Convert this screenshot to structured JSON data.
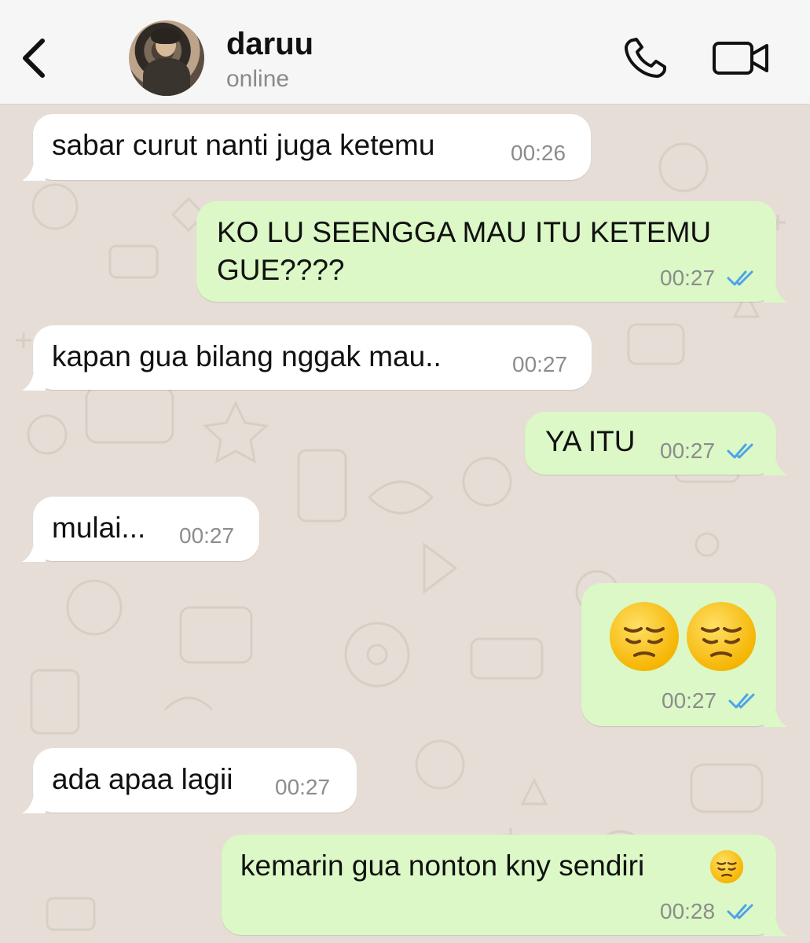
{
  "contact": {
    "name": "daruu",
    "status": "online"
  },
  "colors": {
    "incoming_bubble": "#ffffff",
    "outgoing_bubble": "#dbf8c6",
    "read_ticks": "#4fa3e8",
    "header_bg": "#f6f6f6",
    "chat_bg": "#e6ded6"
  },
  "icons": {
    "back": "chevron-left-icon",
    "call": "phone-icon",
    "video": "video-camera-icon",
    "read": "double-check-icon",
    "emoji": "pensive-face-emoji"
  },
  "messages": [
    {
      "direction": "in",
      "text": "sabar curut nanti juga ketemu",
      "time": "00:26"
    },
    {
      "direction": "out",
      "text_line1": "KO LU SEENGGA MAU ITU KETEMU",
      "text_line2": "GUE????",
      "time": "00:27",
      "read": true
    },
    {
      "direction": "in",
      "text": "kapan gua bilang nggak mau..",
      "time": "00:27"
    },
    {
      "direction": "out",
      "text": "YA ITU",
      "time": "00:27",
      "read": true
    },
    {
      "direction": "in",
      "text": "mulai...",
      "time": "00:27"
    },
    {
      "direction": "out",
      "emoji": "😔😔",
      "time": "00:27",
      "read": true
    },
    {
      "direction": "in",
      "text": "ada apaa lagii",
      "time": "00:27"
    },
    {
      "direction": "out",
      "text": "kemarin gua nonton kny sendiri",
      "emoji": "😔",
      "time": "00:28",
      "read": true
    }
  ]
}
